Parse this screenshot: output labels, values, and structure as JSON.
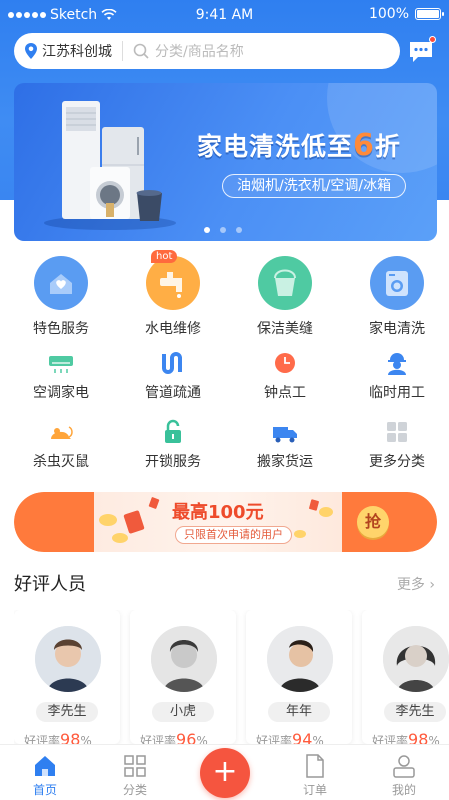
{
  "status_bar": {
    "carrier": "Sketch",
    "time": "9:41 AM",
    "battery": "100%"
  },
  "header": {
    "location": "江苏科创城",
    "search_placeholder": "分类/商品名称"
  },
  "banner": {
    "headline_pre": "家电清洗低至",
    "headline_num": "6",
    "headline_post": "折",
    "subtitle": "油烟机/洗衣机/空调/冰箱",
    "page_count": 3,
    "active_page": 1
  },
  "categories_primary": [
    {
      "label": "特色服务",
      "icon": "heart-hands-icon",
      "color": "#4a90ee"
    },
    {
      "label": "水电维修",
      "icon": "faucet-icon",
      "color": "#ff9f2f",
      "badge": "hot"
    },
    {
      "label": "保洁美缝",
      "icon": "bucket-icon",
      "color": "#39c19a"
    },
    {
      "label": "家电清洗",
      "icon": "washing-machine-icon",
      "color": "#4a90ee"
    }
  ],
  "categories_secondary": [
    {
      "label": "空调家电",
      "icon": "air-conditioner-icon"
    },
    {
      "label": "管道疏通",
      "icon": "pipe-icon"
    },
    {
      "label": "钟点工",
      "icon": "clock-icon"
    },
    {
      "label": "临时用工",
      "icon": "worker-icon"
    },
    {
      "label": "杀虫灭鼠",
      "icon": "mouse-icon"
    },
    {
      "label": "开锁服务",
      "icon": "lock-icon"
    },
    {
      "label": "搬家货运",
      "icon": "truck-icon"
    },
    {
      "label": "更多分类",
      "icon": "grid-icon"
    }
  ],
  "promo": {
    "title": "最高100元",
    "subtitle": "只限首次申请的用户",
    "button": "抢"
  },
  "section": {
    "title": "好评人员",
    "more": "更多"
  },
  "people": [
    {
      "name": "李先生",
      "rate_label": "好评率",
      "rate": "98",
      "unit": "%"
    },
    {
      "name": "小虎",
      "rate_label": "好评率",
      "rate": "96",
      "unit": "%"
    },
    {
      "name": "年年",
      "rate_label": "好评率",
      "rate": "94",
      "unit": "%"
    },
    {
      "name": "李先生",
      "rate_label": "好评率",
      "rate": "98",
      "unit": "%"
    }
  ],
  "tabbar": {
    "home": "首页",
    "category": "分类",
    "orders": "订单",
    "mine": "我的",
    "add": "+"
  },
  "colors": {
    "primary": "#2f7ff0",
    "accent": "#f5553f"
  }
}
